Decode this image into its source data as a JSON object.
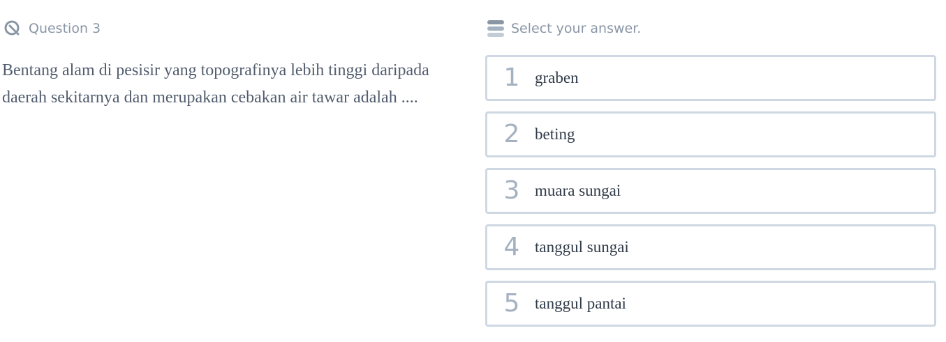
{
  "question": {
    "label": "Question 3",
    "icon": "question-search-icon",
    "text": "Bentang alam di pesisir yang topografinya lebih tinggi daripada daerah sekitarnya dan merupakan cebakan air tawar adalah ...."
  },
  "answers": {
    "icon": "list-icon",
    "prompt": "Select your answer.",
    "options": [
      {
        "number": "1",
        "text": "graben"
      },
      {
        "number": "2",
        "text": "beting"
      },
      {
        "number": "3",
        "text": "muara sungai"
      },
      {
        "number": "4",
        "text": "tanggul sungai"
      },
      {
        "number": "5",
        "text": "tanggul pantai"
      }
    ]
  },
  "colors": {
    "border": "#cfd8e2",
    "muted": "#8a96a6",
    "number": "#a3b1c0",
    "question_text": "#515c6d",
    "option_text": "#2f3a48"
  }
}
